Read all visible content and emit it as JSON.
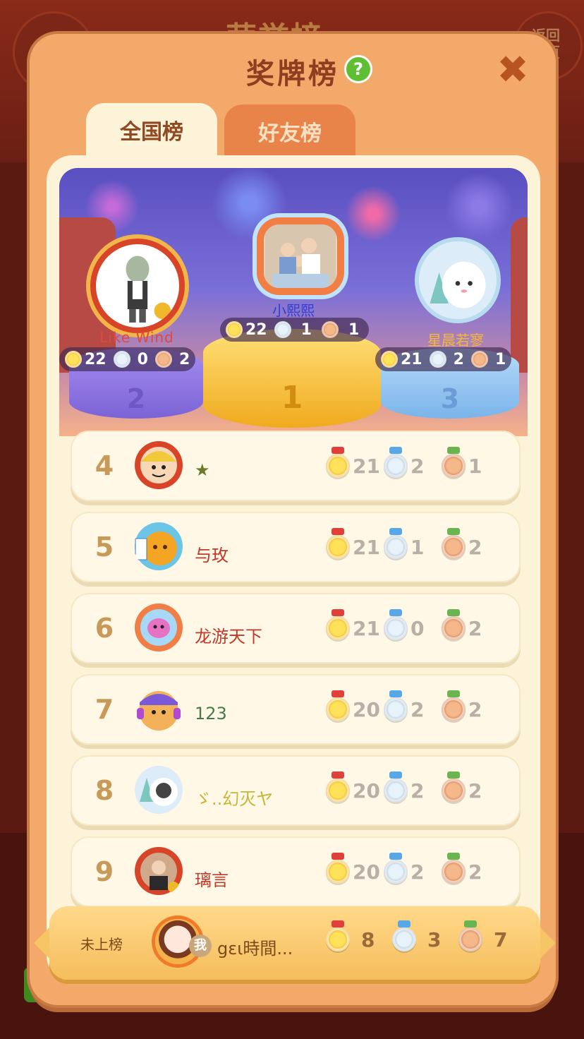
{
  "background": {
    "title": "荣誉榜",
    "return_label": "返回\n主页"
  },
  "panel": {
    "title": "奖牌榜",
    "help_symbol": "?",
    "close_symbol": "✖"
  },
  "tabs": {
    "national": "全国榜",
    "friends": "好友榜"
  },
  "podium": {
    "first": {
      "name": "小熙熙",
      "gold": "22",
      "silver": "1",
      "bronze": "1",
      "pedestal": "1"
    },
    "second": {
      "name": "Like Wind",
      "gold": "22",
      "silver": "0",
      "bronze": "2",
      "pedestal": "2"
    },
    "third": {
      "name": "星晨若寥",
      "gold": "21",
      "silver": "2",
      "bronze": "1",
      "pedestal": "3"
    }
  },
  "rows": [
    {
      "rank": "4",
      "name": "★",
      "gold": "21",
      "silver": "2",
      "bronze": "1",
      "name_color": "#6b7a2a"
    },
    {
      "rank": "5",
      "name": "与玫",
      "gold": "21",
      "silver": "1",
      "bronze": "2",
      "name_color": "#c0392b"
    },
    {
      "rank": "6",
      "name": "龙游天下",
      "gold": "21",
      "silver": "0",
      "bronze": "2",
      "name_color": "#c0392b"
    },
    {
      "rank": "7",
      "name": "123",
      "gold": "20",
      "silver": "2",
      "bronze": "2",
      "name_color": "#4a7a4a"
    },
    {
      "rank": "8",
      "name": "ゞ..幻灭ヤ",
      "gold": "20",
      "silver": "2",
      "bronze": "2",
      "name_color": "#c9b53a"
    },
    {
      "rank": "9",
      "name": "璃言",
      "gold": "20",
      "silver": "2",
      "bronze": "2",
      "name_color": "#c0392b"
    }
  ],
  "self": {
    "rank_label": "未上榜",
    "me_badge": "我",
    "name": "gɛι時間...",
    "gold": "8",
    "silver": "3",
    "bronze": "7"
  },
  "colors": {
    "panel": "#f3a96a",
    "inner": "#fdf3d8",
    "accent_title": "#8e3d20",
    "gold": "#f5c032",
    "silver": "#b7c8d6",
    "bronze": "#d98a54"
  }
}
